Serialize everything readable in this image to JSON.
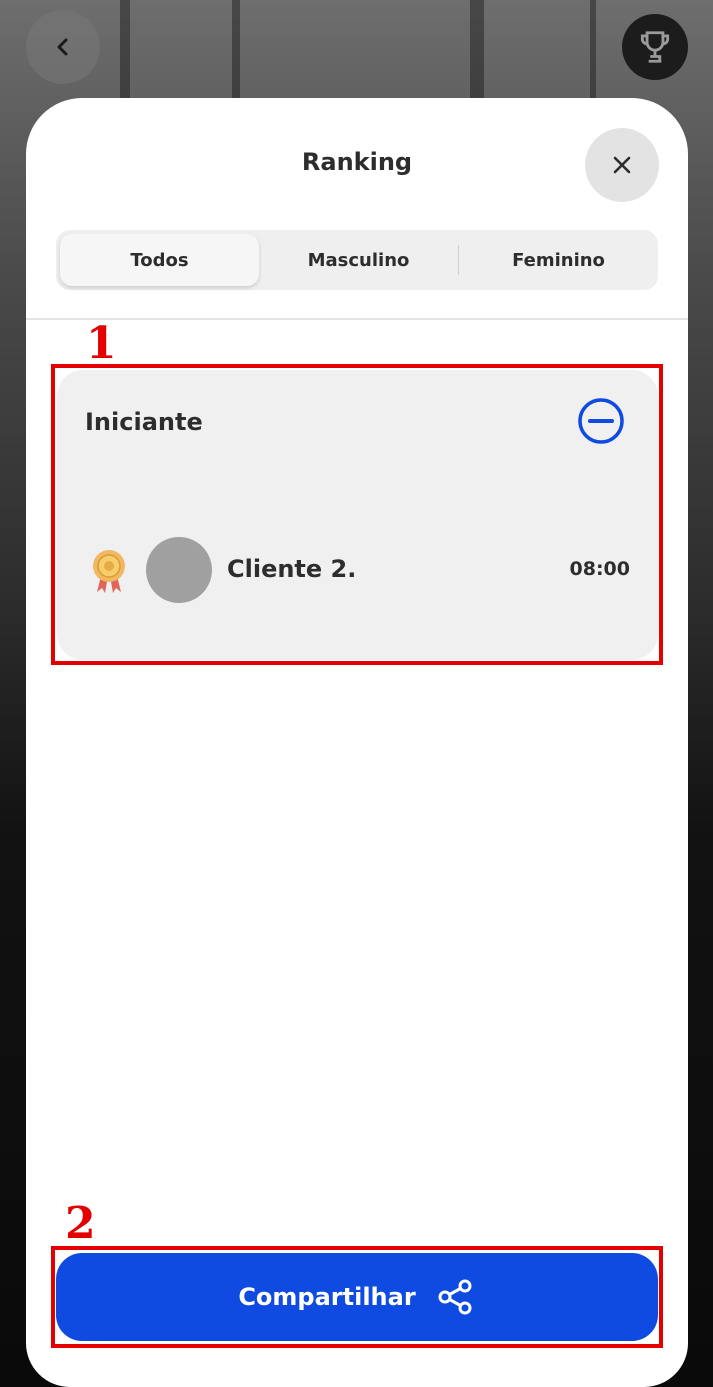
{
  "header": {
    "back_icon": "chevron-left-icon",
    "trophy_icon": "trophy-icon"
  },
  "modal": {
    "title": "Ranking",
    "close_icon": "close-icon",
    "tabs": [
      {
        "label": "Todos",
        "active": true
      },
      {
        "label": "Masculino",
        "active": false
      },
      {
        "label": "Feminino",
        "active": false
      }
    ]
  },
  "annotations": {
    "marker_1": "1",
    "marker_2": "2",
    "color": "#e40000"
  },
  "ranking": {
    "category": "Iniciante",
    "collapse_icon": "minus-circle-icon",
    "entries": [
      {
        "medal_icon": "medal-icon",
        "name": "Cliente 2.",
        "time": "08:00"
      }
    ]
  },
  "footer": {
    "share_label": "Compartilhar",
    "share_icon": "share-icon",
    "accent": "#0f4be0"
  }
}
